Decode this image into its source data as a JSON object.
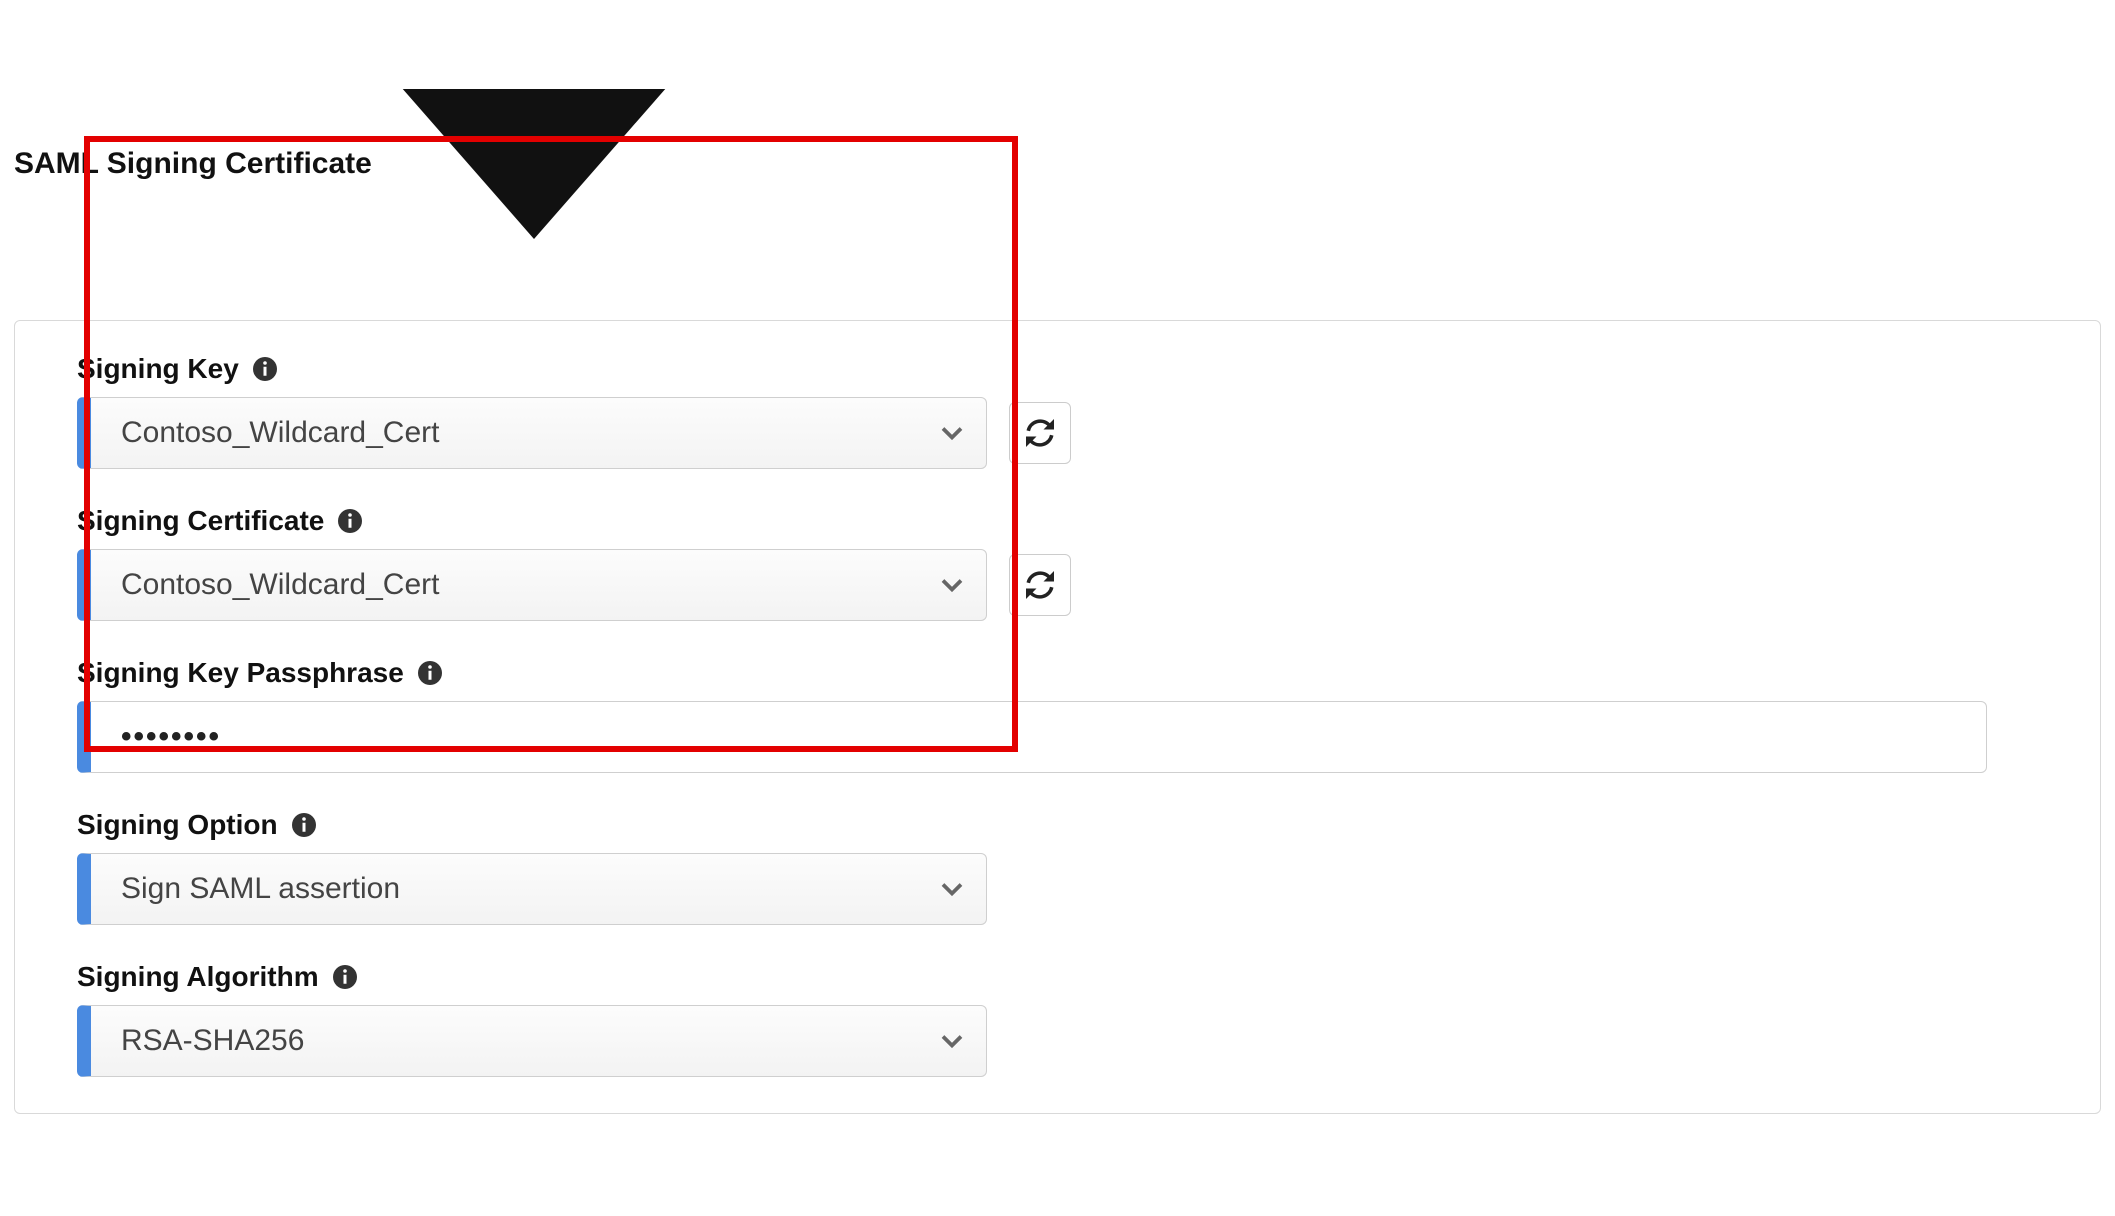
{
  "section": {
    "title": "SAML Signing Certificate"
  },
  "fields": {
    "signingKey": {
      "label": "Signing Key",
      "value": "Contoso_Wildcard_Cert"
    },
    "signingCertificate": {
      "label": "Signing Certificate",
      "value": "Contoso_Wildcard_Cert"
    },
    "signingKeyPassphrase": {
      "label": "Signing Key Passphrase",
      "masked_value": "••••••••"
    },
    "signingOption": {
      "label": "Signing Option",
      "value": "Sign SAML assertion"
    },
    "signingAlgorithm": {
      "label": "Signing Algorithm",
      "value": "RSA-SHA256"
    }
  }
}
